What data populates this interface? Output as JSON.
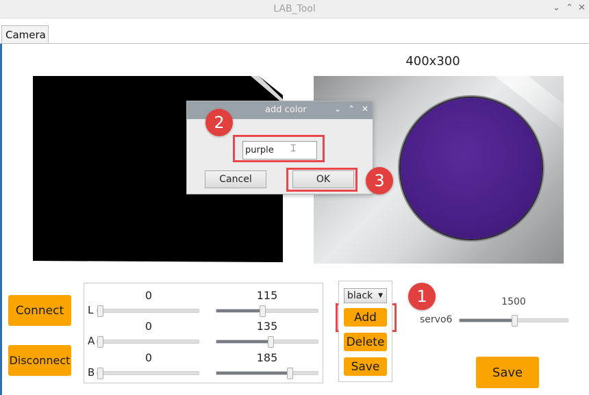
{
  "window": {
    "title": "LAB_Tool",
    "controls": [
      "⌄",
      "⌃",
      "✕"
    ]
  },
  "tabs": [
    {
      "label": "Camera"
    }
  ],
  "preview": {
    "resolution": "400x300"
  },
  "dialog": {
    "title": "add color",
    "controls": [
      "⌄",
      "⌃",
      "✕"
    ],
    "input_value": "purple",
    "cancel_label": "Cancel",
    "ok_label": "OK"
  },
  "callouts": [
    "1",
    "2",
    "3"
  ],
  "connection": {
    "connect_label": "Connect",
    "disconnect_label": "Disconnect"
  },
  "lab": {
    "channels": [
      {
        "label": "L",
        "min": 0,
        "max": 115,
        "min_frac": 0.0,
        "max_frac": 0.45
      },
      {
        "label": "A",
        "min": 0,
        "max": 135,
        "min_frac": 0.0,
        "max_frac": 0.53
      },
      {
        "label": "B",
        "min": 0,
        "max": 185,
        "min_frac": 0.0,
        "max_frac": 0.73
      }
    ]
  },
  "color": {
    "selected": "black",
    "add_label": "Add",
    "delete_label": "Delete",
    "save_label": "Save"
  },
  "servo": {
    "label": "servo6",
    "value": 1500,
    "frac": 0.5
  },
  "footer": {
    "save_label": "Save"
  },
  "colors": {
    "accent": "#fba400",
    "callout": "#e8464a",
    "dialog_title": "#99a2a8"
  }
}
